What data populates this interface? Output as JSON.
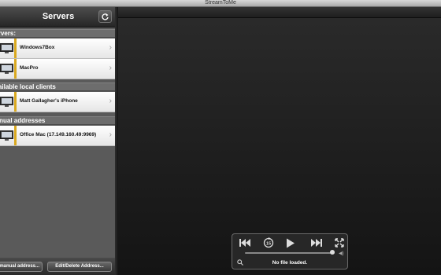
{
  "window": {
    "title": "StreamToMe"
  },
  "sidebar": {
    "title": "Servers",
    "sections": [
      {
        "header": "Servers:",
        "rows": [
          "Windows7Box",
          "MacPro"
        ]
      },
      {
        "header": "Available local clients",
        "rows": [
          "Matt Gallagher's iPhone"
        ]
      },
      {
        "header": "Manual addresses",
        "rows": [
          "Office Mac (17.149.160.49:9969)"
        ]
      }
    ],
    "bottom_buttons": [
      "Add manual address...",
      "Edit/Delete Address..."
    ]
  },
  "player": {
    "status": "No file loaded.",
    "seek_fraction": 0.97
  },
  "colors": {
    "accent_stripe": "#d9a81f"
  }
}
